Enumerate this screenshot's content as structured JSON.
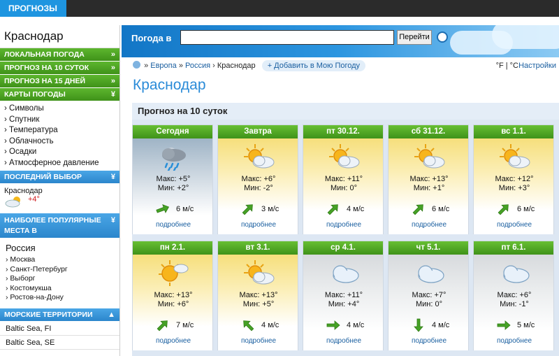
{
  "top_tab": "ПРОГНОЗЫ",
  "sidebar": {
    "city_title": "Краснодар",
    "sections": [
      "ЛОКАЛЬНАЯ ПОГОДА",
      "ПРОГНОЗ НА 10 СУТОК",
      "ПРОГНОЗ НА 15 ДНЕЙ",
      "КАРТЫ ПОГОДЫ"
    ],
    "map_links": [
      "› Символы",
      "› Спутник",
      "› Температура",
      "› Облачность",
      "› Осадки",
      "› Атмосферное давление"
    ],
    "last_choice_title": "ПОСЛЕДНИЙ ВЫБОР",
    "last_city": "Краснодар",
    "last_temp": "+4°",
    "popular_title": "НАИБОЛЕЕ ПОПУЛЯРНЫЕ МЕСТА В",
    "popular_country": "Россия",
    "popular_links": [
      "› Москва",
      "› Санкт-Петербург",
      "› Выборг",
      "› Костомукша",
      "› Ростов-на-Дону"
    ],
    "sea_title": "МОРСКИЕ ТЕРРИТОРИИ",
    "sea_items": [
      "Baltic Sea, FI",
      "Baltic Sea, SE"
    ]
  },
  "search": {
    "label": "Погода в",
    "value": "",
    "go_label": "Перейти"
  },
  "breadcrumb": {
    "sep1": "»",
    "europe": "Европа",
    "sep2": "»",
    "russia": "Россия",
    "sep3": "›",
    "city": "Краснодар",
    "add_label": "+ Добавить в Мою Погоду",
    "units": "°F | °C",
    "settings": "Настройки"
  },
  "page_title": "Краснодар",
  "forecast": {
    "title": "Прогноз на 10 суток",
    "more_label": "подробнее",
    "days": [
      {
        "day": "Сегодня",
        "icon": "rain-cloud-icon",
        "max": "Макс: +5°",
        "min": "Мин: +2°",
        "wind": "6 м/с",
        "wind_dir": "east-northeast",
        "style": "rain"
      },
      {
        "day": "Завтра",
        "icon": "sun-cloud-icon",
        "max": "Макс: +6°",
        "min": "Мин: -2°",
        "wind": "3 м/с",
        "wind_dir": "northeast",
        "style": "sunny"
      },
      {
        "day": "пт 30.12.",
        "icon": "sun-cloud-icon",
        "max": "Макс: +11°",
        "min": "Мин: 0°",
        "wind": "4 м/с",
        "wind_dir": "northeast",
        "style": "sunny"
      },
      {
        "day": "сб 31.12.",
        "icon": "sun-cloud-icon",
        "max": "Макс: +13°",
        "min": "Мин: +1°",
        "wind": "6 м/с",
        "wind_dir": "northeast",
        "style": "sunny"
      },
      {
        "day": "вс 1.1.",
        "icon": "sun-cloud-icon",
        "max": "Макс: +12°",
        "min": "Мин: +3°",
        "wind": "6 м/с",
        "wind_dir": "northeast",
        "style": "sunny"
      },
      {
        "day": "пн 2.1.",
        "icon": "sun-small-cloud-icon",
        "max": "Макс: +13°",
        "min": "Мин: +6°",
        "wind": "7 м/с",
        "wind_dir": "northeast",
        "style": "sunny"
      },
      {
        "day": "вт 3.1.",
        "icon": "sun-cloud-icon",
        "max": "Макс: +13°",
        "min": "Мин: +5°",
        "wind": "4 м/с",
        "wind_dir": "northwest",
        "style": "sunny"
      },
      {
        "day": "ср 4.1.",
        "icon": "cloud-icon",
        "max": "Макс: +11°",
        "min": "Мин: +4°",
        "wind": "4 м/с",
        "wind_dir": "east",
        "style": "cloudy"
      },
      {
        "day": "чт 5.1.",
        "icon": "cloud-icon",
        "max": "Макс: +7°",
        "min": "Мин: 0°",
        "wind": "4 м/с",
        "wind_dir": "south",
        "style": "cloudy"
      },
      {
        "day": "пт 6.1.",
        "icon": "cloud-icon",
        "max": "Макс: +6°",
        "min": "Мин: -1°",
        "wind": "5 м/с",
        "wind_dir": "east",
        "style": "cloudy"
      }
    ]
  },
  "colors": {
    "green": "#3f9219",
    "blue": "#2b86cc",
    "link": "#1a5fa0",
    "title": "#2a8bd8",
    "warm": "#d0181b"
  }
}
